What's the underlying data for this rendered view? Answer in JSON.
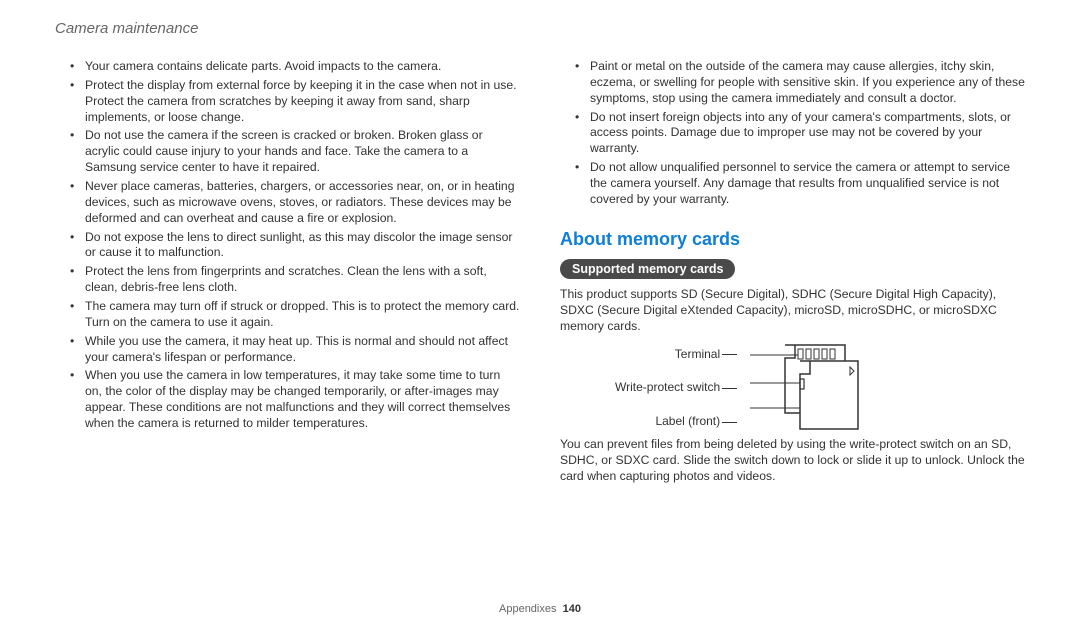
{
  "header": "Camera maintenance",
  "left_bullets": [
    "Your camera contains delicate parts. Avoid impacts to the camera.",
    "Protect the display from external force by keeping it in the case when not in use. Protect the camera from scratches by keeping it away from sand, sharp implements, or loose change.",
    "Do not use the camera if the screen is cracked or broken. Broken glass or acrylic could cause injury to your hands and face. Take the camera to a Samsung service center to have it repaired.",
    "Never place cameras, batteries, chargers, or accessories near, on, or in heating devices, such as microwave ovens, stoves, or radiators. These devices may be deformed and can overheat and cause a fire or explosion.",
    "Do not expose the lens to direct sunlight, as this may discolor the image sensor or cause it to malfunction.",
    "Protect the lens from fingerprints and scratches. Clean the lens with a soft, clean, debris-free lens cloth.",
    "The camera may turn off if struck or dropped. This is to protect the memory card. Turn on the camera to use it again.",
    "While you use the camera, it may heat up. This is normal and should not affect your camera's lifespan or performance.",
    "When you use the camera in low temperatures, it may take some time to turn on, the color of the display may be changed temporarily, or after-images may appear. These conditions are not malfunctions and they will correct themselves when the camera is returned to milder temperatures."
  ],
  "right_bullets": [
    "Paint or metal on the outside of the camera may cause allergies, itchy skin, eczema, or swelling for people with sensitive skin. If you experience any of these symptoms, stop using the camera immediately and consult a doctor.",
    "Do not insert foreign objects into any of your camera's compartments, slots, or access points. Damage due to improper use may not be covered by your warranty.",
    "Do not allow unqualified personnel to service the camera or attempt to service the camera yourself. Any damage that results from unqualified service is not covered by your warranty."
  ],
  "section_title": "About memory cards",
  "pill_label": "Supported memory cards",
  "supported_text": "This product supports SD (Secure Digital), SDHC (Secure Digital High Capacity), SDXC (Secure Digital eXtended Capacity), microSD, microSDHC, or microSDXC memory cards.",
  "diagram_labels": {
    "terminal": "Terminal",
    "write_protect": "Write-protect switch",
    "label_front": "Label (front)"
  },
  "write_protect_text": "You can prevent files from being deleted by using the write-protect switch on an SD, SDHC, or SDXC card. Slide the switch down to lock or slide it up to unlock. Unlock the card when capturing photos and videos.",
  "footer_section": "Appendixes",
  "footer_page": "140"
}
